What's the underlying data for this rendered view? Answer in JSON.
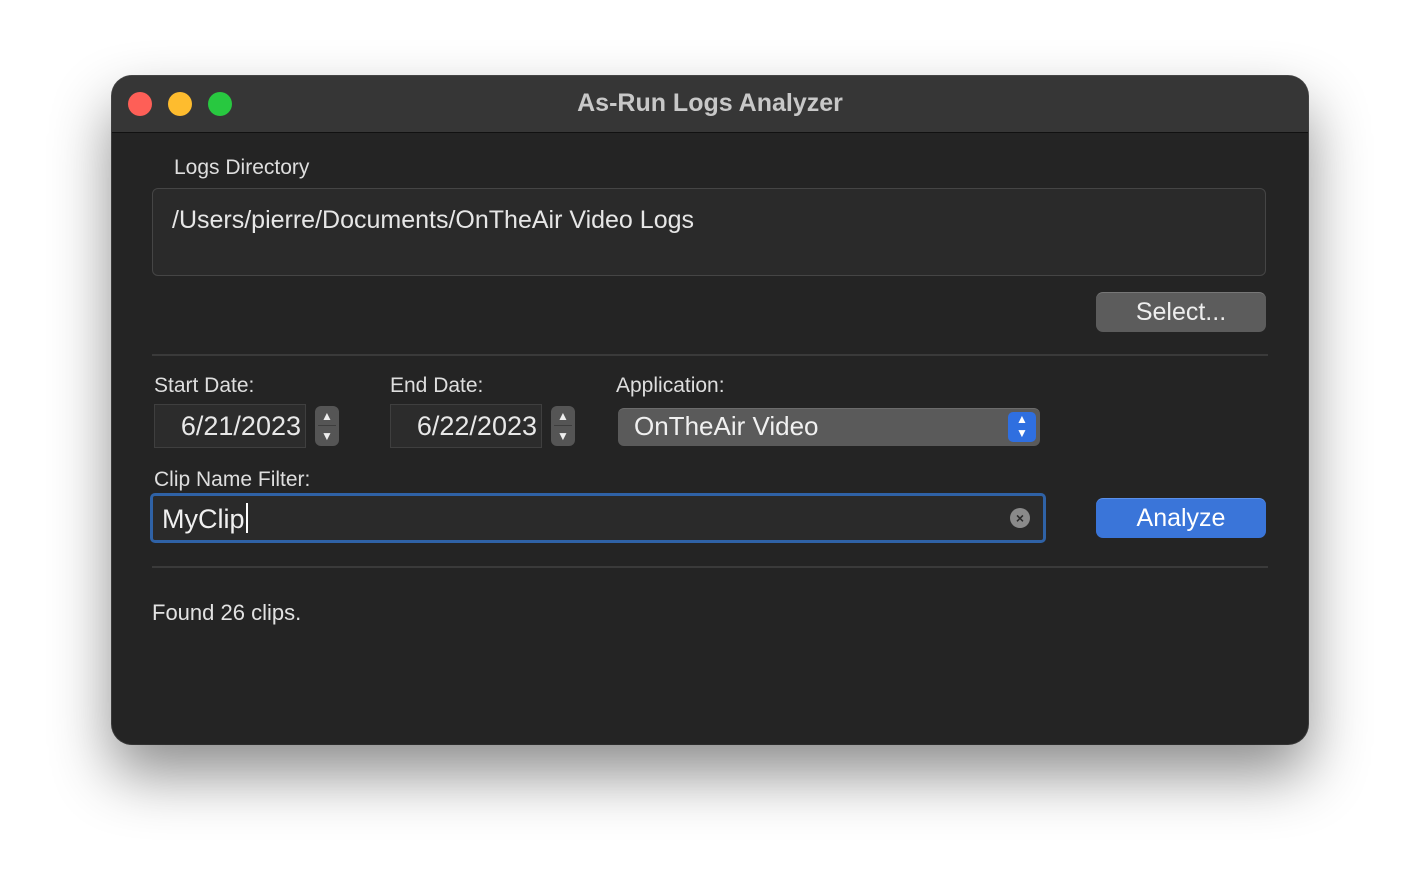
{
  "window": {
    "title": "As-Run Logs Analyzer"
  },
  "logs_directory": {
    "label": "Logs Directory",
    "path": "/Users/pierre/Documents/OnTheAir Video Logs",
    "select_button": "Select..."
  },
  "start_date": {
    "label": "Start Date:",
    "value": "6/21/2023"
  },
  "end_date": {
    "label": "End Date:",
    "value": "6/22/2023"
  },
  "application": {
    "label": "Application:",
    "selected": "OnTheAir Video"
  },
  "clip_filter": {
    "label": "Clip Name Filter:",
    "value": "MyClip"
  },
  "analyze_button": "Analyze",
  "status": "Found 26 clips.",
  "colors": {
    "accent": "#3a75d9",
    "window_bg": "#242424",
    "close": "#fe5f57",
    "minimize": "#febc2e",
    "zoom": "#28c840"
  }
}
